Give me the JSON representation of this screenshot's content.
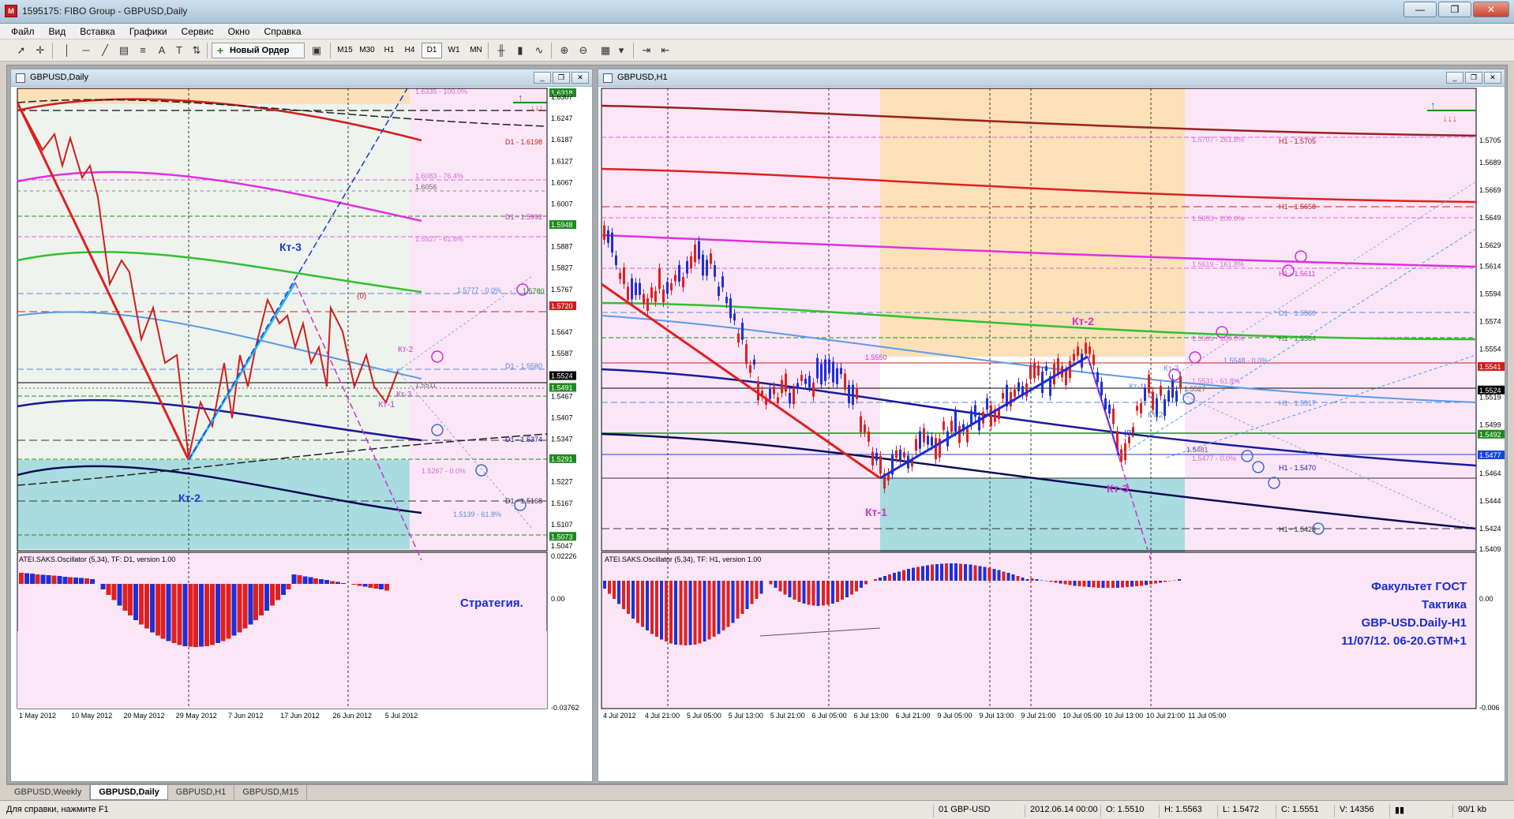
{
  "window": {
    "title": "1595175: FIBO Group - GBPUSD,Daily",
    "app_icon": "mt4-icon",
    "controls": [
      "—",
      "❐",
      "✕"
    ]
  },
  "menu": [
    "Файл",
    "Вид",
    "Вставка",
    "Графики",
    "Сервис",
    "Окно",
    "Справка"
  ],
  "toolbar": {
    "new_order": "Новый Ордер",
    "timeframes": [
      "M15",
      "M30",
      "H1",
      "H4",
      "D1",
      "W1",
      "MN"
    ],
    "active_timeframe": "D1"
  },
  "left_chart": {
    "title": "GBPUSD,Daily",
    "price_labels": [
      "1.6318",
      "1.6307",
      "1.6247",
      "1.6187",
      "1.6127",
      "1.6067",
      "1.6007",
      "1.5948",
      "1.5887",
      "1.5827",
      "1.5767",
      "1.5720",
      "1.5647",
      "1.5587",
      "1.5524",
      "1.5491",
      "1.5467",
      "1.5407",
      "1.5347",
      "1.5291",
      "1.5227",
      "1.5167",
      "1.5107",
      "1.5073",
      "1.5047"
    ],
    "highlight_labels": {
      "1.6318": "#1e8a1e",
      "1.5948": "#1e8a1e",
      "1.5720": "#d21d1d",
      "1.5524": "#000000",
      "1.5491": "#1e8a1e",
      "1.5291": "#1e8a1e",
      "1.5073": "#1e8a1e"
    },
    "date_labels": [
      "1 May 2012",
      "10 May 2012",
      "20 May 2012",
      "29 May 2012",
      "7 Jun 2012",
      "17 Jun 2012",
      "26 Jun 2012",
      "5 Jul 2012"
    ],
    "level_labels": {
      "fib100": "1.6335 - 100.0%",
      "d1_1": "D1 - 1.6198",
      "fib76": "1.6083 - 76.4%",
      "p6056": "1.6056",
      "d1_2": "D1 - 1.5992",
      "fib61": "1.5927 - 61.8%",
      "fib0": "1.5777 - 0.0%",
      "p5780": "1.5780",
      "d1_3": "D1 - 1.5580",
      "p5511": "1.5511",
      "d1_4": "D1 - 1.5374",
      "fib0b": "1.5267 - 0.0%",
      "d1_5": "D1 - 1.5168",
      "fib61b": "1.5139 - 61.8%"
    },
    "annotations": {
      "kt3": "Кт-3",
      "kt2": "Кт-2",
      "kt1": "Кт-1",
      "kt3s": "Кт-3",
      "kt2s": "Кт-2",
      "zero": "(0)"
    },
    "indicator": {
      "title": "ATEI.SAKS.Oscillator (5,34), TF: D1, version 1.00",
      "scale": [
        "0.02226",
        "0.00",
        "-0.03762"
      ],
      "caption": "Стратегия."
    }
  },
  "right_chart": {
    "title": "GBPUSD,H1",
    "price_labels": [
      "1.5705",
      "1.5689",
      "1.5669",
      "1.5649",
      "1.5629",
      "1.5614",
      "1.5594",
      "1.5574",
      "1.5554",
      "1.5541",
      "1.5524",
      "1.5519",
      "1.5499",
      "1.5492",
      "1.5477",
      "1.5464",
      "1.5444",
      "1.5424",
      "1.5409"
    ],
    "highlight_labels": {
      "1.5541": "#d21d1d",
      "1.5524": "#000000",
      "1.5492": "#1e8a1e",
      "1.5477": "#1846d8"
    },
    "date_labels": [
      "4 Jul 2012",
      "4 Jul 21:00",
      "5 Jul 05:00",
      "5 Jul 13:00",
      "5 Jul 21:00",
      "6 Jul 05:00",
      "6 Jul 13:00",
      "6 Jul 21:00",
      "9 Jul 05:00",
      "9 Jul 13:00",
      "9 Jul 21:00",
      "10 Jul 05:00",
      "10 Jul 13:00",
      "10 Jul 21:00",
      "11 Jul 05:00"
    ],
    "level_labels": {
      "fib261": "1.5707 - 261.8%",
      "h1_1": "H1 - 1.5705",
      "h1_2": "H1 - 1.5658",
      "fib200": "1.5653 - 200.0%",
      "fib161": "1.5619 - 161.8%",
      "h1_3": "H1 - 1.5611",
      "d1_1": "D1 - 1.5580",
      "fib100": "1.5565 - 100.0%",
      "h1_4": "H1 - 1.5564",
      "p5550": "1.5550",
      "fib0": "1.5548 - 0.0%",
      "fib61": "1.5531 - 61.8%",
      "p5527": "1.5527",
      "h1_5": "H1 - 1.5517",
      "p5481": "1.5481",
      "fib0b": "1.5477 - 0.0%",
      "h1_6": "H1 - 1.5470",
      "h1_7": "H1 - 1.5423"
    },
    "annotations": {
      "kt2": "Кт-2",
      "kt1": "Кт-1",
      "kt3": "Кт-3",
      "kt3s": "Кт-3",
      "kt1s": "Кт-1",
      "kt2s": "Кт-2",
      "zero": "(0)"
    },
    "indicator": {
      "title": "ATEI.SAKS.Oscillator (5,34), TF: H1, version 1.00",
      "scale": [
        "0.00",
        "-0.006"
      ],
      "caption_lines": [
        "Факультет ГОСТ",
        "Тактика",
        "GBP-USD.Daily-H1",
        "11/07/12. 06-20.GTM+1"
      ]
    }
  },
  "tabs": [
    "GBPUSD,Weekly",
    "GBPUSD,Daily",
    "GBPUSD,H1",
    "GBPUSD,M15"
  ],
  "active_tab": "GBPUSD,Daily",
  "status": {
    "help": "Для справки, нажмите F1",
    "profile": "01 GBP-USD",
    "datetime": "2012.06.14 00:00",
    "open": "O: 1.5510",
    "high": "H: 1.5563",
    "low": "L: 1.5472",
    "close": "C: 1.5551",
    "volume": "V: 14356",
    "traffic": "90/1 kb"
  },
  "colors": {
    "bull": "#1f2fd8",
    "bear": "#e02020",
    "pink_zone": "#fbe6f7",
    "peach_zone": "#fbe0b8",
    "teal_zone": "#a8dcdf"
  }
}
